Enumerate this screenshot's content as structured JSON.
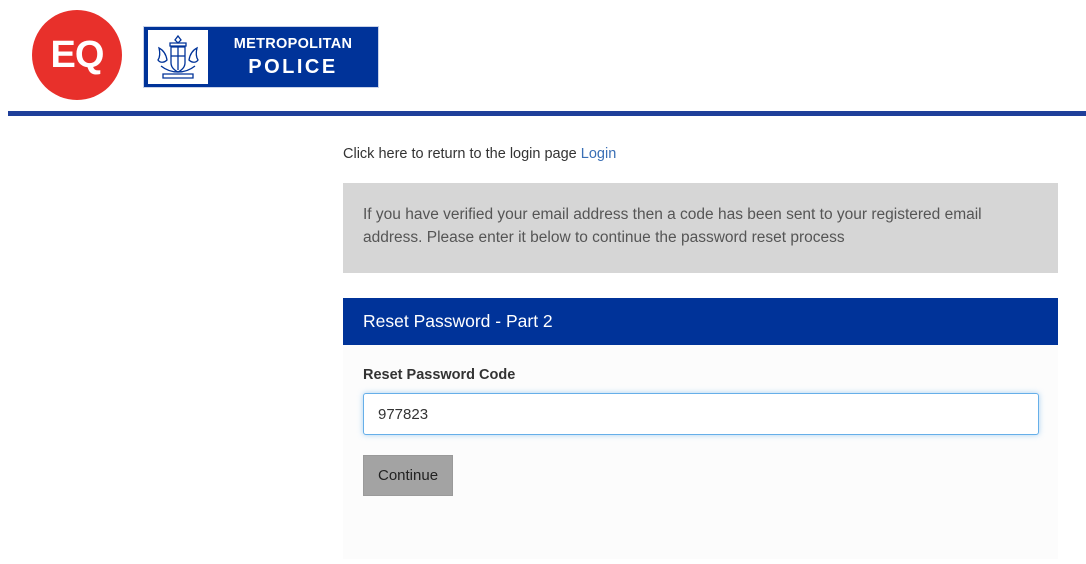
{
  "header": {
    "eq_logo_text": "EQ",
    "met_logo_line1": "METROPOLITAN",
    "met_logo_line2": "POLICE",
    "brand_red": "#e8302b",
    "brand_blue": "#003399"
  },
  "return": {
    "text": "Click here to return to the login page",
    "link_label": "Login"
  },
  "notice": {
    "text": "If you have verified your email address then a code has been sent to your registered email address. Please enter it below to continue the password reset process"
  },
  "panel": {
    "title": "Reset Password - Part 2",
    "field_label": "Reset Password Code",
    "code_value": "977823",
    "continue_label": "Continue"
  }
}
